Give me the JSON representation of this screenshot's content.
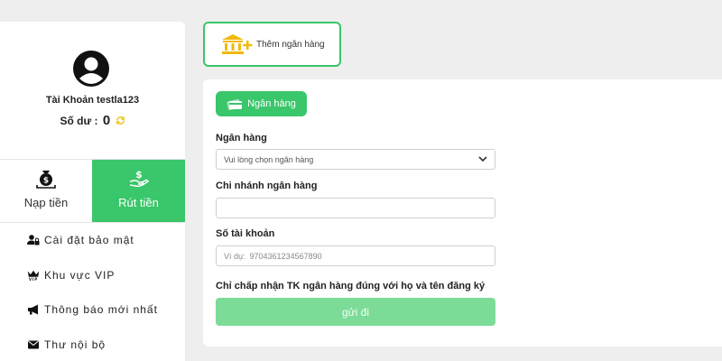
{
  "profile": {
    "username": "Tài Khoản testla123",
    "balance_label": "Số dư :",
    "balance_value": "0"
  },
  "actions": {
    "deposit_label": "Nạp tiền",
    "withdraw_label": "Rút tiền"
  },
  "menu": {
    "items": [
      {
        "label": "Cài đặt bảo mật",
        "icon": "user-lock-icon"
      },
      {
        "label": "Khu vực VIP",
        "icon": "vip-crown-icon"
      },
      {
        "label": "Thông báo mới nhất",
        "icon": "megaphone-icon"
      },
      {
        "label": "Thư nội bộ",
        "icon": "envelope-icon"
      }
    ]
  },
  "add_bank": {
    "label": "Thêm ngân hàng"
  },
  "form": {
    "tab_label": "Ngân hàng",
    "bank_label": "Ngân hàng",
    "bank_select_value": "Vui lòng chọn ngân hàng",
    "branch_label": "Chi nhánh ngân hàng",
    "branch_value": "",
    "account_label": "Số tài khoản",
    "account_placeholder": "Ví dụ:  9704361234567890",
    "note": "Chỉ chấp nhận TK ngân hàng đúng với họ và tên đăng ký",
    "submit_label": "gửi đi"
  },
  "colors": {
    "accent": "#3ac66a",
    "submit_disabled": "#7ddb98",
    "refresh_icon": "#f0c419",
    "bank_icon": "#f0b90b"
  }
}
